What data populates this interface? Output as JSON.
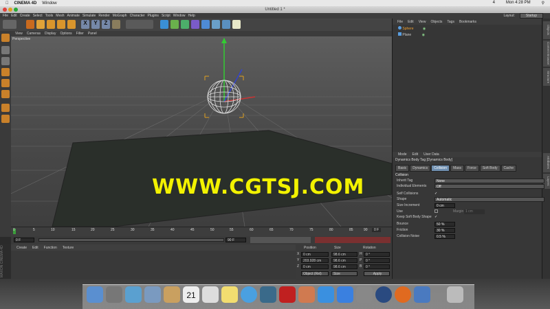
{
  "macmenu": {
    "app": "CINEMA 4D",
    "window": "Window",
    "clock": "Mon 4:28 PM",
    "battery": "4"
  },
  "window": {
    "title": "Untitled 1 *"
  },
  "menu": [
    "File",
    "Edit",
    "Create",
    "Select",
    "Tools",
    "Mesh",
    "Animate",
    "Simulate",
    "Render",
    "MoGraph",
    "Character",
    "Plugins",
    "Script",
    "Window",
    "Help"
  ],
  "layout": {
    "label": "Layout:",
    "value": "Startup"
  },
  "toolbar": {
    "x_label": "X",
    "y_label": "Y",
    "z_label": "Z"
  },
  "viewport": {
    "menu": [
      "View",
      "Cameras",
      "Display",
      "Options",
      "Filter",
      "Panel"
    ],
    "label": "Perspective",
    "watermark": "WWW.CGTSJ.COM"
  },
  "timeline": {
    "ticks": [
      "0",
      "5",
      "10",
      "15",
      "20",
      "25",
      "30",
      "35",
      "40",
      "45",
      "50",
      "55",
      "60",
      "65",
      "70",
      "75",
      "80",
      "85",
      "90"
    ],
    "end_label": "0 F",
    "start": "0 F",
    "end": "90 F",
    "cur": "0 F"
  },
  "material": {
    "menu": [
      "Create",
      "Edit",
      "Function",
      "Texture"
    ],
    "brand": "MAXON CINEMA 4D"
  },
  "coords": {
    "headers": [
      "Position",
      "Size",
      "Rotation"
    ],
    "rows": [
      {
        "axis": "X",
        "pos": "0 cm",
        "size": "98.6 cm",
        "rlabel": "H",
        "rot": "0 °"
      },
      {
        "axis": "Y",
        "pos": "203.928 cm",
        "size": "98.6 cm",
        "rlabel": "P",
        "rot": "0 °"
      },
      {
        "axis": "Z",
        "pos": "0 cm",
        "size": "98.6 cm",
        "rlabel": "B",
        "rot": "0 °"
      }
    ],
    "mode": "Object (Rel)",
    "size_mode": "Size",
    "apply": "Apply"
  },
  "objects": {
    "menu": [
      "File",
      "Edit",
      "View",
      "Objects",
      "Tags",
      "Bookmarks"
    ],
    "items": [
      "Sphere",
      "Plane"
    ]
  },
  "sidetabs": [
    "Objects",
    "Content Browser",
    "Structure",
    "Attributes",
    "Layers"
  ],
  "attributes": {
    "menu": [
      "Mode",
      "Edit",
      "User Data"
    ],
    "title": "Dynamics Body Tag [Dynamics Body]",
    "tabs": [
      "Basic",
      "Dynamics",
      "Collision",
      "Mass",
      "Force",
      "Soft Body",
      "Cache"
    ],
    "section": "Collision",
    "inherit_tag": {
      "label": "Inherit Tag",
      "value": "None"
    },
    "individual": {
      "label": "Individual Elements",
      "value": "Off"
    },
    "self_collisions": {
      "label": "Self Collisions",
      "value": "✓"
    },
    "shape": {
      "label": "Shape",
      "value": "Automatic"
    },
    "size_increment": {
      "label": "Size Increment",
      "value": "0 cm"
    },
    "use": {
      "label": "Use",
      "margin_label": "Margin",
      "margin_value": "1 cm"
    },
    "keep_soft": {
      "label": "Keep Soft Body Shape",
      "value": "✓"
    },
    "bounce": {
      "label": "Bounce",
      "value": "50 %"
    },
    "friction": {
      "label": "Friction",
      "value": "30 %"
    },
    "noise": {
      "label": "Collision Noise",
      "value": "0.5 %"
    }
  },
  "dock": {
    "calendar_day": "21"
  }
}
